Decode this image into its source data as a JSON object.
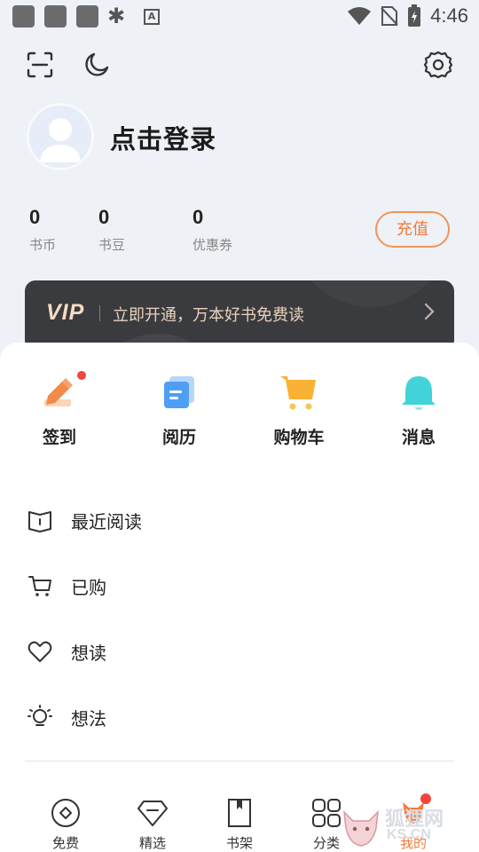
{
  "status_bar": {
    "time": "4:46",
    "badge_letter": "A"
  },
  "profile": {
    "login_text": "点击登录"
  },
  "stats": [
    {
      "value": "0",
      "label": "书币"
    },
    {
      "value": "0",
      "label": "书豆"
    },
    {
      "value": "0",
      "label": "优惠券"
    }
  ],
  "recharge_label": "充值",
  "vip": {
    "logo": "VIP",
    "text": "立即开通，万本好书免费读"
  },
  "quick_actions": [
    {
      "label": "签到",
      "icon": "sign-in-icon"
    },
    {
      "label": "阅历",
      "icon": "history-icon"
    },
    {
      "label": "购物车",
      "icon": "cart-icon"
    },
    {
      "label": "消息",
      "icon": "bell-icon"
    }
  ],
  "menu": [
    {
      "label": "最近阅读",
      "icon": "book-icon"
    },
    {
      "label": "已购",
      "icon": "cart-outline-icon"
    },
    {
      "label": "想读",
      "icon": "heart-icon"
    },
    {
      "label": "想法",
      "icon": "bulb-icon"
    }
  ],
  "bottom_nav": [
    {
      "label": "免费",
      "icon": "coin-icon"
    },
    {
      "label": "精选",
      "icon": "diamond-icon"
    },
    {
      "label": "书架",
      "icon": "bookshelf-icon"
    },
    {
      "label": "分类",
      "icon": "grid-icon"
    },
    {
      "label": "我的",
      "icon": "fox-icon"
    }
  ],
  "watermark": {
    "line1": "狐狸网",
    "line2": "KS.CN"
  },
  "colors": {
    "accent": "#f07b3a",
    "vip_bg": "#3a3b3e",
    "page_bg": "#eef1f5"
  }
}
